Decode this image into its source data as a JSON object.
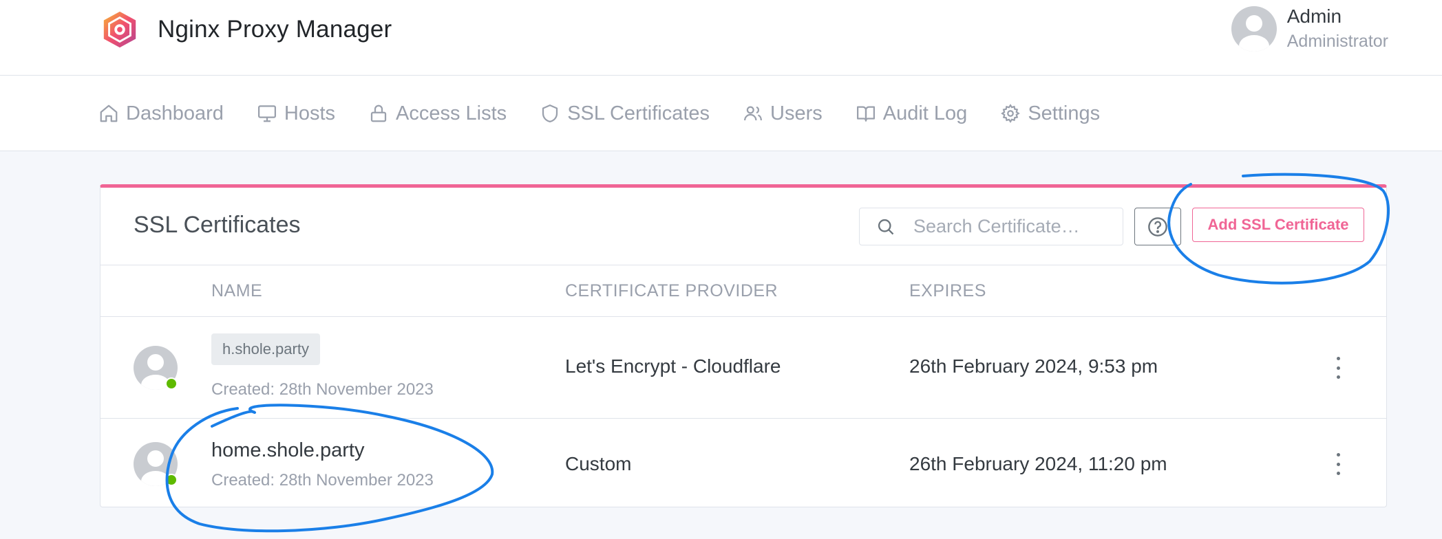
{
  "app": {
    "title": "Nginx Proxy Manager",
    "logo_icon": "hexagon-logo-icon"
  },
  "user": {
    "name": "Admin",
    "role": "Administrator",
    "avatar_icon": "user-avatar-icon"
  },
  "nav": {
    "items": [
      {
        "label": "Dashboard",
        "icon": "home-icon"
      },
      {
        "label": "Hosts",
        "icon": "monitor-icon"
      },
      {
        "label": "Access Lists",
        "icon": "lock-icon"
      },
      {
        "label": "SSL Certificates",
        "icon": "shield-icon"
      },
      {
        "label": "Users",
        "icon": "users-icon"
      },
      {
        "label": "Audit Log",
        "icon": "book-icon"
      },
      {
        "label": "Settings",
        "icon": "gear-icon"
      }
    ]
  },
  "card": {
    "title": "SSL Certificates",
    "accent_color": "#f06595",
    "search_placeholder": "Search Certificate…",
    "help_icon": "help-circle-icon",
    "add_button_label": "Add SSL Certificate"
  },
  "table": {
    "columns": [
      "NAME",
      "CERTIFICATE PROVIDER",
      "EXPIRES"
    ],
    "rows": [
      {
        "domain": "h.shole.party",
        "created": "Created: 28th November 2023",
        "provider": "Let's Encrypt - Cloudflare",
        "expires": "26th February 2024, 9:53 pm",
        "status_color": "#5eba00"
      },
      {
        "domain": "home.shole.party",
        "created": "Created: 28th November 2023",
        "provider": "Custom",
        "expires": "26th February 2024, 11:20 pm",
        "status_color": "#5eba00"
      }
    ]
  },
  "annotation_color": "#1a7fe8"
}
